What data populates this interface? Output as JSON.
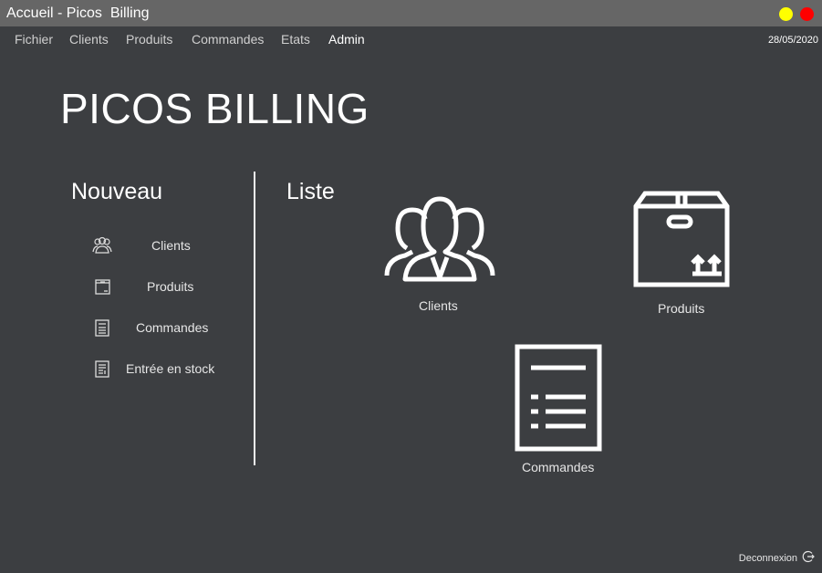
{
  "window": {
    "title": "Accueil - Picos  Billing",
    "minimize_color": "#ffff00",
    "close_color": "#ff0000"
  },
  "menu": {
    "items": [
      "Fichier",
      "Clients",
      "Produits",
      "Commandes",
      "Etats",
      "Admin"
    ],
    "date": "28/05/2020"
  },
  "app_title": "PICOS BILLING",
  "nouveau": {
    "title": "Nouveau",
    "items": [
      {
        "label": "Clients",
        "icon": "users-icon"
      },
      {
        "label": "Produits",
        "icon": "box-icon"
      },
      {
        "label": "Commandes",
        "icon": "order-list-icon"
      },
      {
        "label": "Entrée en stock",
        "icon": "stock-entry-icon"
      }
    ]
  },
  "liste": {
    "title": "Liste",
    "tiles": [
      {
        "label": "Clients",
        "icon": "users-icon"
      },
      {
        "label": "Produits",
        "icon": "box-icon"
      },
      {
        "label": "Commandes",
        "icon": "order-list-icon"
      }
    ]
  },
  "logout": {
    "label": "Deconnexion",
    "icon": "logout-icon"
  }
}
